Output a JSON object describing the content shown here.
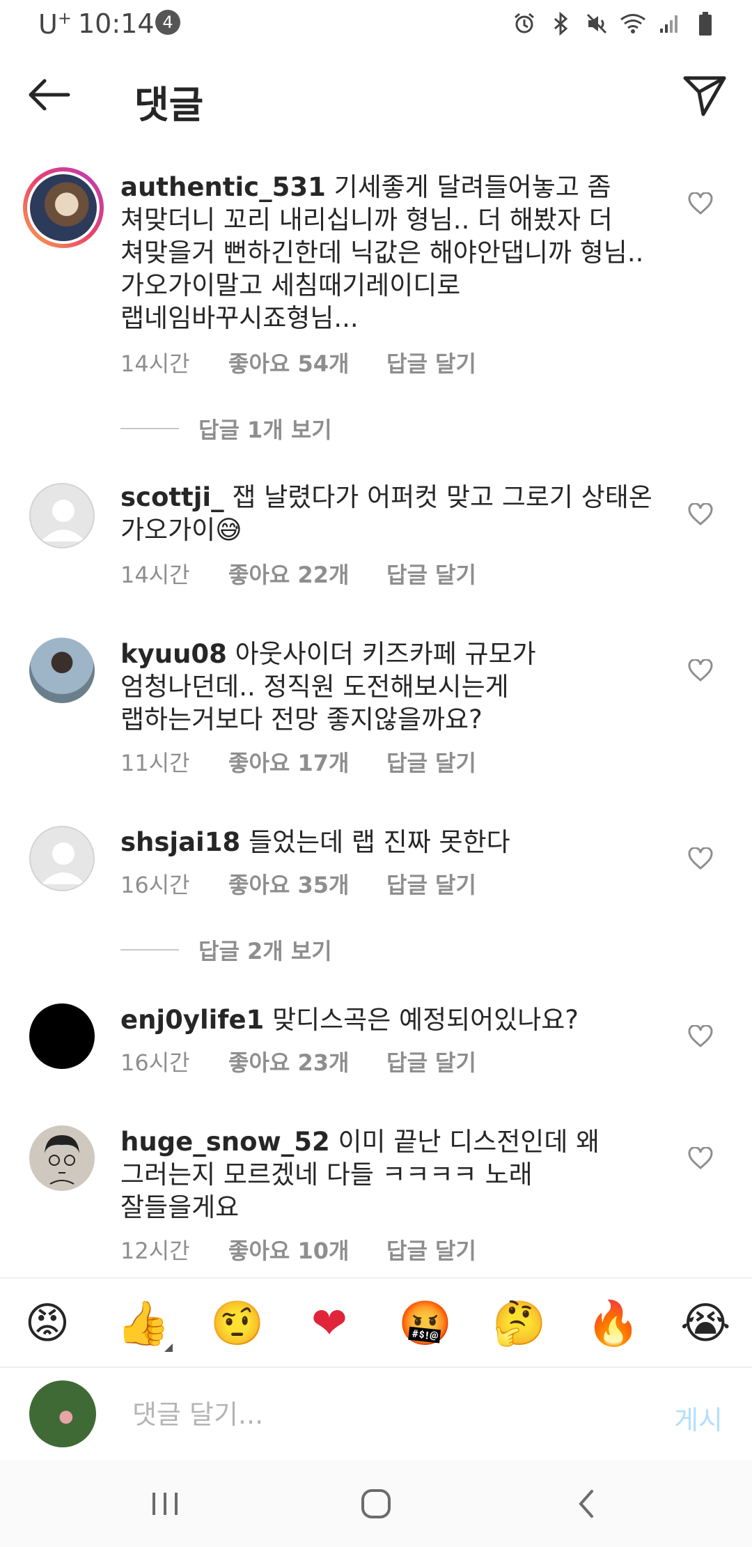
{
  "status_bar": {
    "carrier": "U",
    "carrier_sup": "+",
    "time": "10:14",
    "notification_count": "4"
  },
  "header": {
    "title": "댓글"
  },
  "comments": [
    {
      "username": "authentic_531",
      "text": "기세좋게 달려들어놓고 좀 쳐맞더니 꼬리 내리십니까 형님.. 더 해봤자 더 쳐맞을거 뻔하긴한데 닉값은 해야안댑니까 형님.. 가오가이말고 세침때기레이디로 랩네임바꾸시죠형님...",
      "time": "14시간",
      "likes": "좋아요 54개",
      "reply": "답글 달기",
      "view_replies": "답글 1개 보기"
    },
    {
      "username": "scottji_",
      "text": "잽 날렸다가 어퍼컷 맞고 그로기 상태온 가오가이😅",
      "time": "14시간",
      "likes": "좋아요 22개",
      "reply": "답글 달기"
    },
    {
      "username": "kyuu08",
      "text": "아웃사이더 키즈카페 규모가 엄청나던데.. 정직원 도전해보시는게 랩하는거보다 전망 좋지않을까요?",
      "time": "11시간",
      "likes": "좋아요 17개",
      "reply": "답글 달기"
    },
    {
      "username": "shsjai18",
      "text": "들었는데 랩 진짜 못한다",
      "time": "16시간",
      "likes": "좋아요 35개",
      "reply": "답글 달기",
      "view_replies": "답글 2개 보기"
    },
    {
      "username": "enj0ylife1",
      "text": "맞디스곡은 예정되어있나요?",
      "time": "16시간",
      "likes": "좋아요 23개",
      "reply": "답글 달기"
    },
    {
      "username": "huge_snow_52",
      "text": "이미 끝난 디스전인데 왜 그러는지 모르겠네 다들 ㅋㅋㅋㅋ 노래 잘들을게요",
      "time": "12시간",
      "likes": "좋아요 10개",
      "reply": "답글 달기"
    }
  ],
  "emoji_bar": [
    "😡",
    "👍",
    "🤨",
    "❤",
    "🤬",
    "🤔",
    "🔥",
    "😭"
  ],
  "comment_input": {
    "placeholder": "댓글 달기...",
    "post_label": "게시"
  },
  "icons": {
    "back": "arrow-left-icon",
    "share": "paper-plane-icon",
    "heart": "heart-outline-icon",
    "nav_recent": "recent-apps-icon",
    "nav_home": "home-icon",
    "nav_back": "chevron-left-icon"
  },
  "colors": {
    "post_button": "#b2dffc",
    "meta_text": "#8e8e8e",
    "text": "#262626"
  }
}
